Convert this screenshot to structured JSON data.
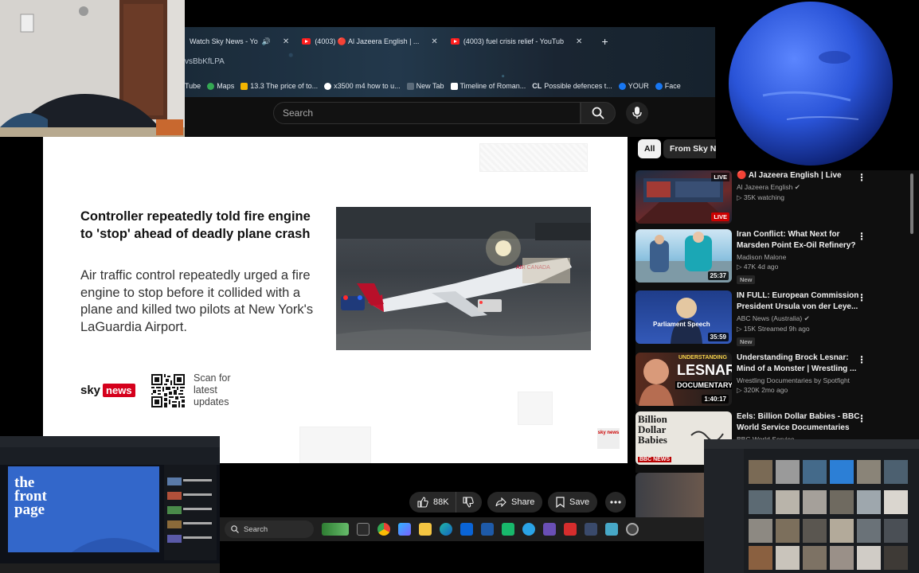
{
  "browser": {
    "tabs": [
      {
        "label": "Watch Sky News - Yo",
        "close": "✕"
      },
      {
        "label": "(4003) 🔴 Al Jazeera English | ...",
        "close": "✕"
      },
      {
        "label": "(4003) fuel crisis relief - YouTub",
        "close": "✕"
      }
    ],
    "new_tab": "+",
    "address": "vsBbKfLPA",
    "bookmarks": [
      "Tube",
      "Maps",
      "13.3 The price of to...",
      "x3500 m4 how to u...",
      "New Tab",
      "Timeline of Roman...",
      "Possible defences t...",
      "YOUR",
      "Face"
    ]
  },
  "search": {
    "placeholder": "Search"
  },
  "video": {
    "headline": "Controller repeatedly told fire engine to 'stop' ahead of deadly plane crash",
    "body": "Air traffic control repeatedly urged a fire engine to stop before it collided with a plane and killed two pilots at New York's LaGuardia Airport.",
    "brand_sky": "sky",
    "brand_news": "news",
    "scan_text": "Scan for latest updates",
    "plane_livery": "AIR CANADA",
    "corner_logo": "sky news"
  },
  "actions": {
    "likes": "88K",
    "share": "Share",
    "save": "Save"
  },
  "chips": {
    "all": "All",
    "from_channel": "From Sky News"
  },
  "recommendations": [
    {
      "title": "🔴 Al Jazeera English | Live",
      "channel": "Al Jazeera English",
      "stats": "▷ 35K watching",
      "badge": "",
      "duration": "",
      "live": "LIVE"
    },
    {
      "title": "Iran Conflict: What Next for Marsden Point Ex-Oil Refinery?",
      "channel": "Madison Malone",
      "stats": "▷ 47K  4d ago",
      "badge": "New",
      "duration": "25:37",
      "live": ""
    },
    {
      "title": "IN FULL: European Commission President Ursula von der Leye...",
      "channel": "ABC News (Australia)",
      "stats": "▷ 15K  Streamed 9h ago",
      "badge": "New",
      "duration": "35:59",
      "live": ""
    },
    {
      "title": "Understanding Brock Lesnar: Mind of a Monster | Wrestling ...",
      "channel": "Wrestling Documentaries by Spotfight",
      "stats": "▷ 320K  2mo ago",
      "badge": "",
      "duration": "1:40:17",
      "live": ""
    },
    {
      "title": "Eels: Billion Dollar Babies - BBC World Service Documentaries",
      "channel": "BBC World Service",
      "stats": "",
      "badge": "",
      "duration": "",
      "live": ""
    }
  ],
  "thumb_text": {
    "parliament": "Parliament Speech",
    "lesnar_1": "UNDERSTANDING",
    "lesnar_2": "LESNAR",
    "lesnar_3": "DOCUMENTARY",
    "eels_1": "Billion",
    "eels_2": "Dollar",
    "eels_3": "Babies",
    "eels_tag": "BBC NEWS"
  },
  "taskbar": {
    "search_placeholder": "Search"
  },
  "mini_left": {
    "title_line1": "the",
    "title_line2": "front",
    "title_line3": "page"
  },
  "colors": {
    "youtube_red": "#ff0000",
    "sky_red": "#d5001c",
    "bg_dark": "#0f0f0f",
    "chip_bg": "#272727"
  }
}
